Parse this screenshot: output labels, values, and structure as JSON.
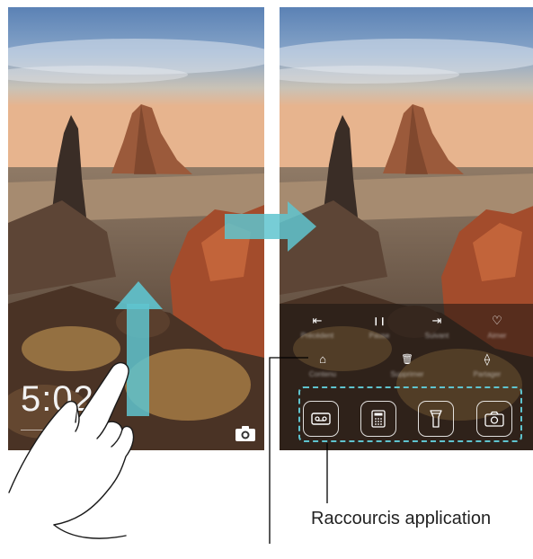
{
  "lock_screen": {
    "time": "5:02",
    "camera_icon": "camera-icon"
  },
  "control_panel": {
    "media_controls": [
      {
        "icon": "previous-icon",
        "glyph": "⇤",
        "label": "Précédent"
      },
      {
        "icon": "pause-icon",
        "glyph": "❙❙",
        "label": "Pause"
      },
      {
        "icon": "next-icon",
        "glyph": "⇥",
        "label": "Suivant"
      },
      {
        "icon": "heart-icon",
        "glyph": "♡",
        "label": "Aimer"
      }
    ],
    "action_controls": [
      {
        "icon": "briefcase-icon",
        "glyph": "⌂",
        "label": "Contenu"
      },
      {
        "icon": "delete-icon",
        "glyph": "🗑",
        "label": "Supprimer"
      },
      {
        "icon": "share-icon",
        "glyph": "⟠",
        "label": "Partager"
      }
    ],
    "shortcuts": [
      {
        "icon": "recorder-icon"
      },
      {
        "icon": "calculator-icon"
      },
      {
        "icon": "flashlight-icon"
      },
      {
        "icon": "camera-icon"
      }
    ]
  },
  "annotations": {
    "shortcuts_caption": "Raccourcis application"
  },
  "colors": {
    "callout_arrow": "#5fc4cf",
    "shortcut_outline": "#5fc4cf",
    "callout_line": "#000000"
  }
}
